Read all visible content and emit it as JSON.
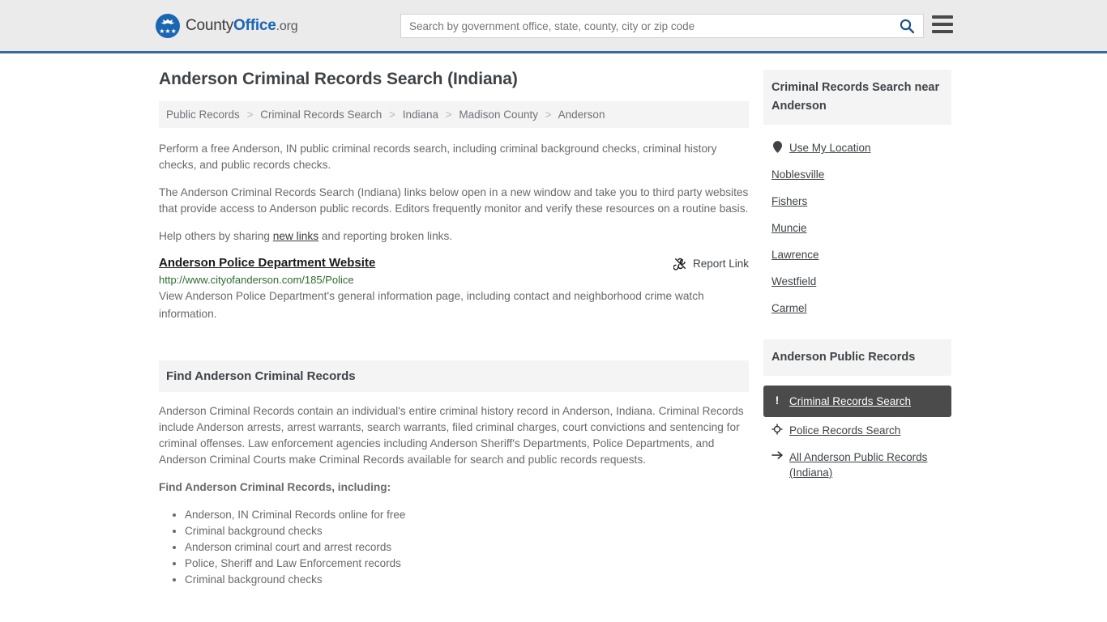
{
  "header": {
    "logo": {
      "text_1": "County",
      "text_bold": "Office",
      "text_suffix": ".org",
      "mark_icon": "eagle-stars-icon",
      "stars": "★★★"
    },
    "search": {
      "placeholder": "Search by government office, state, county, city or zip code",
      "value": "",
      "search_icon": "search-icon"
    },
    "menu_icon": "hamburger-menu-icon",
    "border_color": "#36699e",
    "background": "#ebebeb"
  },
  "page": {
    "title": "Anderson Criminal Records Search (Indiana)",
    "breadcrumb": [
      "Public Records",
      "Criminal Records Search",
      "Indiana",
      "Madison County",
      "Anderson"
    ],
    "breadcrumb_separator": ">",
    "intro_1": "Perform a free Anderson, IN public criminal records search, including criminal background checks, criminal history checks, and public records checks.",
    "intro_2": "The Anderson Criminal Records Search (Indiana) links below open in a new window and take you to third party websites that provide access to Anderson public records. Editors frequently monitor and verify these resources on a routine basis.",
    "help_prefix": "Help others by sharing ",
    "help_link": "new links",
    "help_suffix": " and reporting broken links."
  },
  "record": {
    "title": "Anderson Police Department Website",
    "report_label": "Report Link",
    "report_icon": "broken-link-icon",
    "url": "http://www.cityofanderson.com/185/Police",
    "description": "View Anderson Police Department's general information page, including contact and neighborhood crime watch information."
  },
  "section": {
    "heading": "Find Anderson Criminal Records",
    "paragraph": "Anderson Criminal Records contain an individual's entire criminal history record in Anderson, Indiana. Criminal Records include Anderson arrests, arrest warrants, search warrants, filed criminal charges, court convictions and sentencing for criminal offenses. Law enforcement agencies including Anderson Sheriff's Departments, Police Departments, and Anderson Criminal Courts make Criminal Records available for search and public records requests.",
    "sub_title": "Find Anderson Criminal Records, including:",
    "bullets": [
      "Anderson, IN Criminal Records online for free",
      "Criminal background checks",
      "Anderson criminal court and arrest records",
      "Police, Sheriff and Law Enforcement records",
      "Criminal background checks"
    ]
  },
  "sidebar": {
    "nearby": {
      "heading": "Criminal Records Search near Anderson",
      "use_my_location": {
        "label": "Use My Location",
        "icon": "map-pin-icon"
      },
      "cities": [
        "Noblesville",
        "Fishers",
        "Muncie",
        "Lawrence",
        "Westfield",
        "Carmel"
      ]
    },
    "public_records": {
      "heading": "Anderson Public Records",
      "items": [
        {
          "label": "Criminal Records Search",
          "icon": "exclamation-icon",
          "active": true
        },
        {
          "label": "Police Records Search",
          "icon": "target-crosshair-icon",
          "active": false
        },
        {
          "label": "All Anderson Public Records (Indiana)",
          "icon": "arrow-right-icon",
          "active": false
        }
      ],
      "active_background": "#4b4b4b"
    }
  }
}
